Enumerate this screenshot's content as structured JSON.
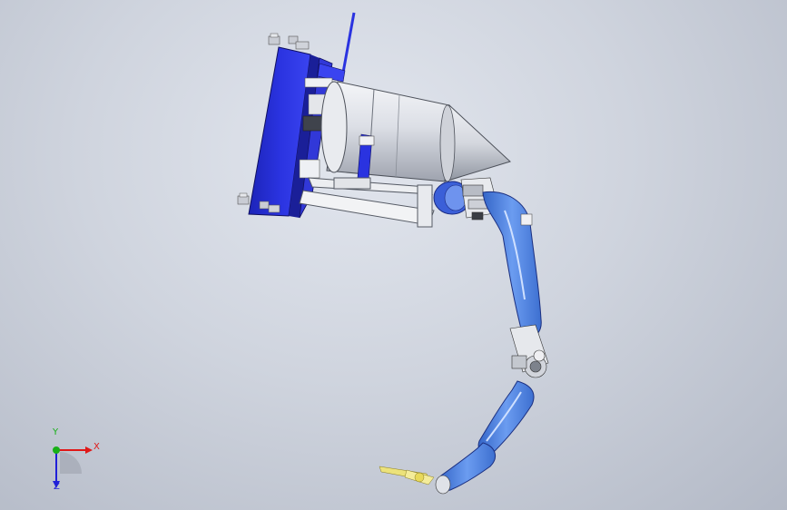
{
  "viewport": {
    "background_top": "#e2e6ee",
    "background_bottom": "#b3b9c6"
  },
  "model": {
    "colors": {
      "plate_blue": "#2a33e0",
      "arm_blue": "#4f84e6",
      "cylinder_grey": "#d8dbe2",
      "frame_white": "#f2f3f5",
      "tool_yellow": "#ece27a"
    }
  },
  "triad": {
    "x_label": "X",
    "y_label": "Y",
    "z_label": "Z",
    "x_color": "#e01818",
    "y_color": "#18b018",
    "z_color": "#2020d8"
  }
}
